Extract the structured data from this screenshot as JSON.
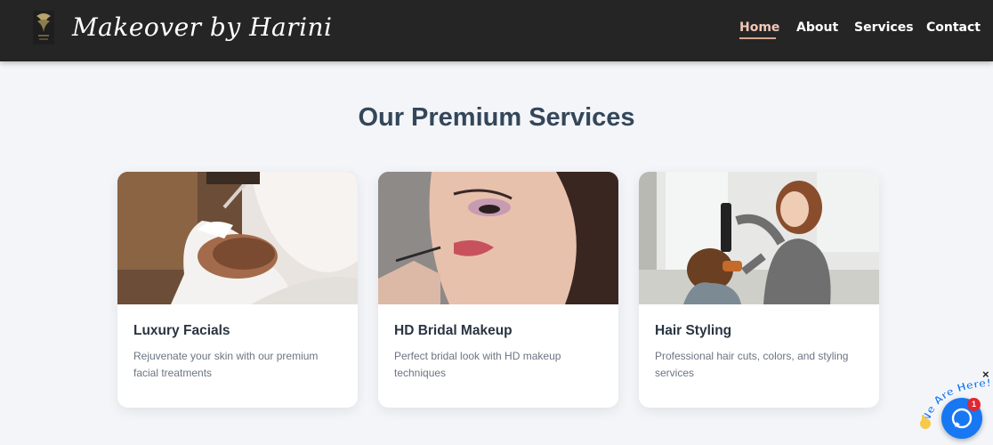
{
  "brand": {
    "name": "Makeover by Harini"
  },
  "nav": {
    "items": [
      {
        "label": "Home",
        "active": true
      },
      {
        "label": "About",
        "active": false
      },
      {
        "label": "Services",
        "active": false
      },
      {
        "label": "Contact",
        "active": false
      }
    ]
  },
  "services": {
    "title": "Our Premium Services",
    "cards": [
      {
        "title": "Luxury Facials",
        "description": "Rejuvenate your skin with our premium facial treatments",
        "image": "facial-treatment-photo"
      },
      {
        "title": "HD Bridal Makeup",
        "description": "Perfect bridal look with HD makeup techniques",
        "image": "bridal-makeup-photo"
      },
      {
        "title": "Hair Styling",
        "description": "Professional hair cuts, colors, and styling services",
        "image": "hair-styling-photo"
      }
    ]
  },
  "chat_widget": {
    "tagline": "We Are Here!",
    "unread_count": "1",
    "close_label": "×"
  },
  "colors": {
    "navbar": "#252525",
    "accent": "#d9a58f",
    "chat": "#1877f2",
    "badge": "#e3262f"
  }
}
